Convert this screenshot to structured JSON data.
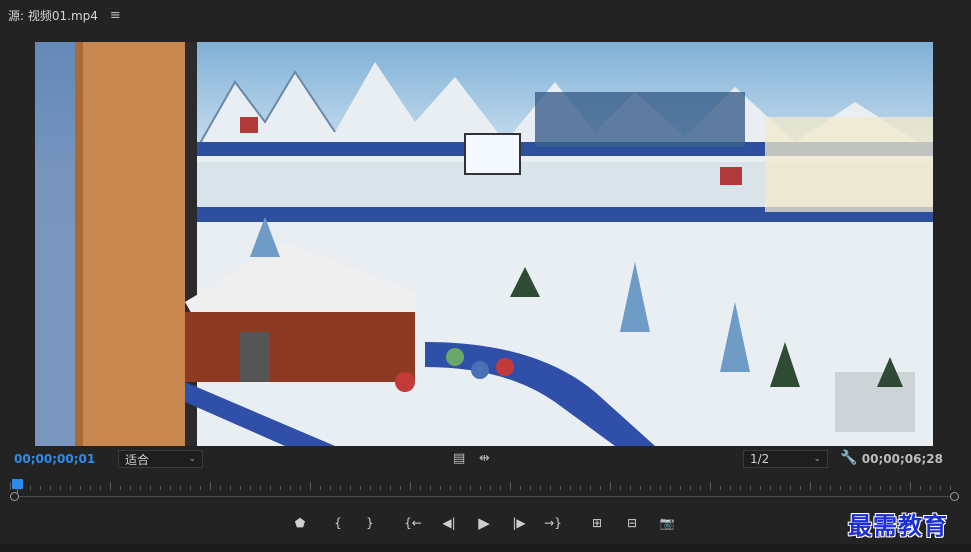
{
  "panel": {
    "title": "源: 视频01.mp4",
    "menu_icon": "hamburger-menu-icon"
  },
  "controls": {
    "current_time": "00;00;00;01",
    "duration": "00;00;06;28",
    "zoom_select": "适合",
    "resolution_select": "1/2",
    "settings_icon": "wrench-icon"
  },
  "transport": {
    "buttons": [
      {
        "name": "add-marker-button",
        "glyph": "⬟"
      },
      {
        "name": "mark-in-button",
        "glyph": "{"
      },
      {
        "name": "mark-out-button",
        "glyph": "}"
      },
      {
        "name": "go-to-in-button",
        "glyph": "{←"
      },
      {
        "name": "step-back-button",
        "glyph": "◀|"
      },
      {
        "name": "play-button",
        "glyph": "▶"
      },
      {
        "name": "step-forward-button",
        "glyph": "|▶"
      },
      {
        "name": "go-to-out-button",
        "glyph": "→}"
      },
      {
        "name": "insert-button",
        "glyph": "⊞"
      },
      {
        "name": "overwrite-button",
        "glyph": "⊟"
      },
      {
        "name": "export-frame-button",
        "glyph": "📷"
      }
    ]
  },
  "playback": {
    "position_fraction": 0.0
  },
  "watermark": "最需教育",
  "colors": {
    "accent": "#2d8ceb",
    "background": "#232323"
  }
}
